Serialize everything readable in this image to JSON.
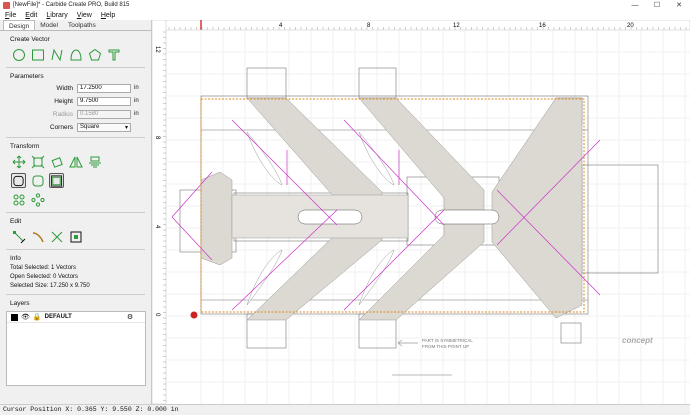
{
  "window": {
    "title": "[NewFile]* - Carbide Create PRO, Build 815",
    "minimize": "—",
    "maximize": "☐",
    "close": "✕"
  },
  "menu": [
    "File",
    "Edit",
    "Library",
    "View",
    "Help"
  ],
  "tabs": [
    "Design",
    "Model",
    "Toolpaths"
  ],
  "create_vector": {
    "title": "Create Vector",
    "icons": [
      "circle-icon",
      "rectangle-icon",
      "polyline-icon",
      "curve-icon",
      "polygon-icon",
      "text-icon"
    ]
  },
  "parameters": {
    "title": "Parameters",
    "width_label": "Width",
    "width_value": "17.2500",
    "width_unit": "in",
    "height_label": "Height",
    "height_value": "9.7500",
    "height_unit": "in",
    "radius_label": "Radius",
    "radius_value": "0.1580",
    "radius_unit": "in",
    "corners_label": "Corners",
    "corners_value": "Square"
  },
  "transform": {
    "title": "Transform"
  },
  "edit": {
    "title": "Edit"
  },
  "info": {
    "title": "Info",
    "total_selected": "Total Selected:  1 Vectors",
    "open_selected": "Open Selected:  0 Vectors",
    "selected_size": "Selected Size:  17.250 x 9.750"
  },
  "layers": {
    "title": "Layers",
    "items": [
      {
        "name": "DEFAULT",
        "color": "#000000"
      }
    ]
  },
  "ruler": {
    "top_ticks": [
      "4",
      "8",
      "12",
      "16",
      "20"
    ],
    "left_ticks": [
      "12",
      "8",
      "4",
      "0"
    ]
  },
  "canvas_note": {
    "line1": "PART IS SYMMETRICAL",
    "line2": "FROM THIS POINT UP"
  },
  "logo_text": "concept",
  "status": {
    "cursor": "Cursor Position X: 0.365 Y: 9.550 Z: 0.000 in"
  },
  "colors": {
    "selection": "#e08a1e",
    "pink": "#cc33cc",
    "part_fill": "#dcd8d2",
    "grid": "#d8d8d8",
    "ruler_marker": "#d00000"
  }
}
